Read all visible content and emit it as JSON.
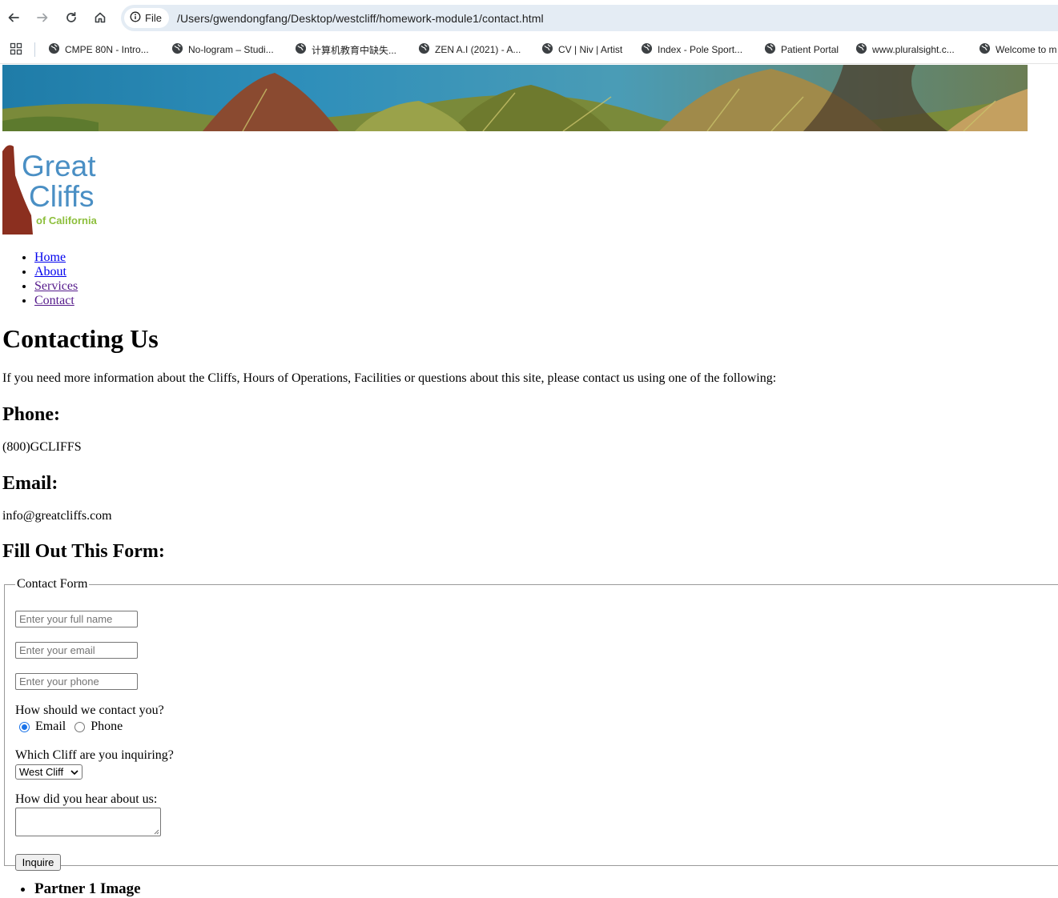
{
  "browser": {
    "chip_label": "File",
    "url": "/Users/gwendongfang/Desktop/westcliff/homework-module1/contact.html",
    "bookmarks": [
      "CMPE 80N - Intro...",
      "No-logram – Studi...",
      "计算机教育中缺失...",
      "ZEN A.I (2021) - A...",
      "CV | Niv | Artist",
      "Index - Pole Sport...",
      "Patient Portal",
      "www.pluralsight.c...",
      "Welcome to m"
    ]
  },
  "logo": {
    "line1": "Great",
    "line2": "Cliffs",
    "line3": "of California",
    "colors": {
      "text": "#4a8fc4",
      "accent": "#8dbf3c",
      "rock": "#8b2f1f"
    }
  },
  "nav": {
    "items": [
      "Home",
      "About",
      "Services",
      "Contact"
    ]
  },
  "page": {
    "title": "Contacting Us",
    "intro": "If you need more information about the Cliffs, Hours of Operations, Facilities or questions about this site, please contact us using one of the following:",
    "phone_heading": "Phone:",
    "phone_value": "(800)GCLIFFS",
    "email_heading": "Email:",
    "email_value": "info@greatcliffs.com",
    "form_heading": "Fill Out This Form:"
  },
  "form": {
    "legend": "Contact Form",
    "name_placeholder": "Enter your full name",
    "email_placeholder": "Enter your email",
    "phone_placeholder": "Enter your phone",
    "contact_question": "How should we contact you?",
    "radio_email": "Email",
    "radio_phone": "Phone",
    "cliff_question": "Which Cliff are you inquiring?",
    "cliff_selected": "West Cliff",
    "hear_question": "How did you hear about us:",
    "submit_label": "Inquire"
  },
  "partners": {
    "first": "Partner 1 Image"
  }
}
